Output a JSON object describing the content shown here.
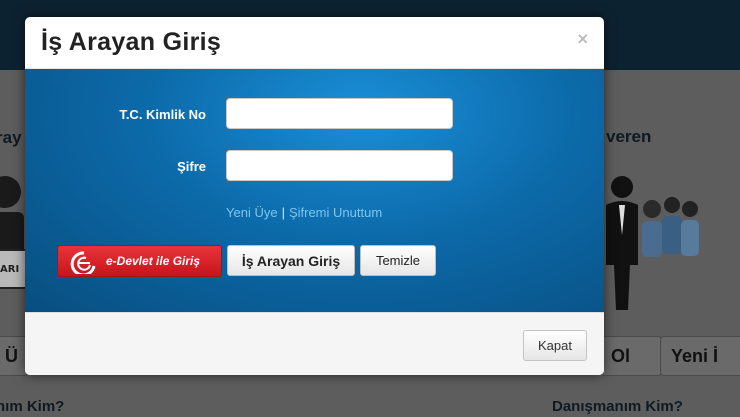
{
  "background": {
    "left_section_title": "ray",
    "right_section_title": "veren",
    "tab_left_partial": "Ü",
    "tab_ol": "Ol",
    "tab_yeni": "Yeni İ",
    "bottom_left": "nım Kim?",
    "bottom_right": "Danışmanım Kim?",
    "sign_text": "ARI"
  },
  "modal": {
    "title": "İş Arayan Giriş",
    "close_glyph": "×",
    "form": {
      "tc_label": "T.C. Kimlik No",
      "tc_value": "",
      "password_label": "Şifre",
      "password_value": ""
    },
    "links": {
      "new_member": "Yeni Üye",
      "separator": "|",
      "forgot_password": "Şifremi Unuttum"
    },
    "buttons": {
      "edevlet": "e-Devlet ile Giriş",
      "login": "İş Arayan Giriş",
      "clear": "Temizle"
    },
    "footer": {
      "close_button": "Kapat"
    }
  },
  "colors": {
    "panel_blue": "#0c6aa9",
    "edevlet_red": "#d9252b",
    "link_blue": "#7fc4f0"
  }
}
